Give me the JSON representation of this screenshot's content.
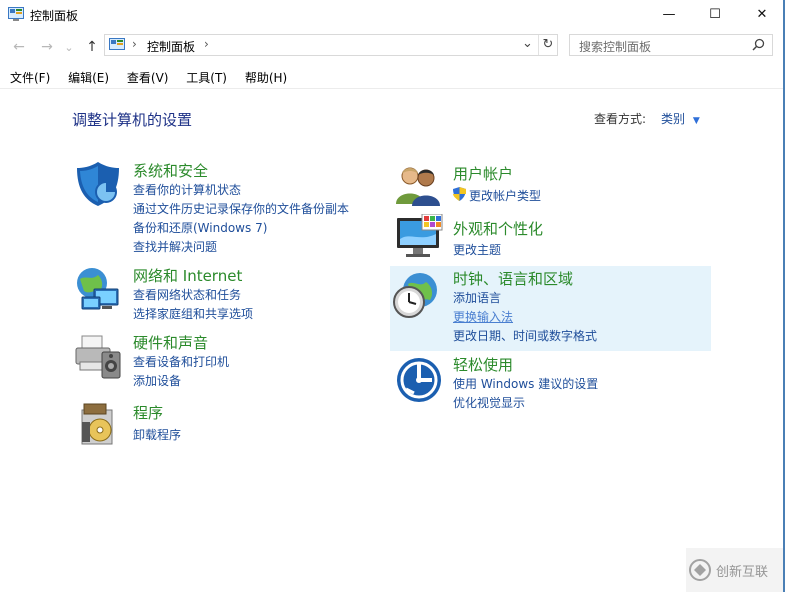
{
  "window": {
    "title": "控制面板",
    "minimize": "—",
    "maximize": "☐",
    "close": "✕"
  },
  "nav": {
    "back": "←",
    "forward": "→",
    "recent": "⌄",
    "up": "↑",
    "breadcrumb": "控制面板",
    "refresh": "↻",
    "dropdown": "⌄",
    "search_placeholder": "搜索控制面板"
  },
  "menubar": [
    "文件(F)",
    "编辑(E)",
    "查看(V)",
    "工具(T)",
    "帮助(H)"
  ],
  "header": {
    "title": "调整计算机的设置",
    "view_label": "查看方式:",
    "view_value": "类别"
  },
  "left_categories": [
    {
      "title": "系统和安全",
      "icon": "shield-icon",
      "links": [
        "查看你的计算机状态",
        "通过文件历史记录保存你的文件备份副本",
        "备份和还原(Windows 7)",
        "查找并解决问题"
      ]
    },
    {
      "title": "网络和 Internet",
      "icon": "network-icon",
      "links": [
        "查看网络状态和任务",
        "选择家庭组和共享选项"
      ]
    },
    {
      "title": "硬件和声音",
      "icon": "printer-icon",
      "links": [
        "查看设备和打印机",
        "添加设备"
      ]
    },
    {
      "title": "程序",
      "icon": "programs-icon",
      "links": [
        "卸载程序"
      ]
    }
  ],
  "right_categories": [
    {
      "title": "用户帐户",
      "icon": "users-icon",
      "links": [
        "更改帐户类型"
      ]
    },
    {
      "title": "外观和个性化",
      "icon": "monitor-icon",
      "links": [
        "更改主题"
      ]
    },
    {
      "title": "时钟、语言和区域",
      "icon": "clock-globe-icon",
      "links": [
        "添加语言",
        "更换输入法",
        "更改日期、时间或数字格式"
      ]
    },
    {
      "title": "轻松使用",
      "icon": "ease-of-access-icon",
      "links": [
        "使用 Windows 建议的设置",
        "优化视觉显示"
      ]
    }
  ],
  "watermark": "创新互联"
}
